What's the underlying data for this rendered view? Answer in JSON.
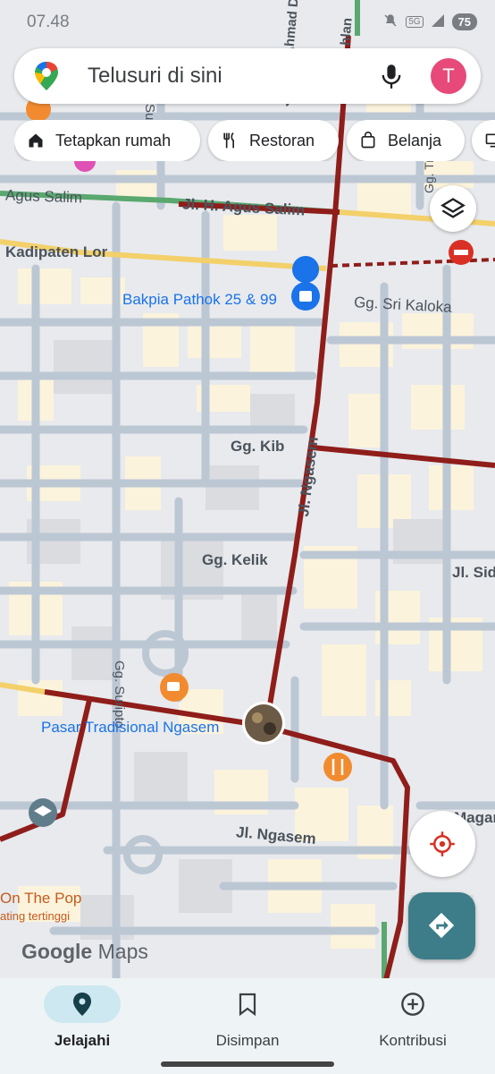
{
  "status_bar": {
    "time": "07.48",
    "network": "5G",
    "battery": "75"
  },
  "search": {
    "placeholder": "Telusuri di sini",
    "avatar_letter": "T"
  },
  "chips": [
    {
      "label": "Tetapkan rumah",
      "icon": "home-icon"
    },
    {
      "label": "Restoran",
      "icon": "restaurant-icon"
    },
    {
      "label": "Belanja",
      "icon": "shopping-bag-icon"
    }
  ],
  "map_labels": {
    "agus_salim_left": "Agus Salim",
    "agus_salim_main": "Jl. H. Agus Salim",
    "kadipaten": "Kadipaten Lor",
    "nyai_ahmad": "Jl. Nyai Ahmad Dahlan",
    "bakpia": "Bakpia Pathok 25 & 99",
    "sri_kaloka": "Gg. Sri Kaloka",
    "kib": "Gg. Kib",
    "ngasem_vertical": "Jl. Ngasem",
    "kelik": "Gg. Kelik",
    "jl_sid": "Jl. Sid",
    "suripto": "Gg. Suripto",
    "pasar": "Pasar Tradisional Ngasem",
    "ngasem_lower": "Jl. Ngasem",
    "magan": "Magan",
    "on_the_pop": "On The Pop",
    "rating": "ating tertinggi",
    "salim_top": "Su",
    "dahlan_top": "hlan",
    "gg_vertical_top": "Gg. Tr"
  },
  "branding": {
    "google": "Google",
    "maps": "Maps"
  },
  "bottom_nav": [
    {
      "label": "Jelajahi",
      "icon": "explore-pin-icon",
      "active": true
    },
    {
      "label": "Disimpan",
      "icon": "bookmark-icon",
      "active": false
    },
    {
      "label": "Kontribusi",
      "icon": "add-circle-icon",
      "active": false
    }
  ],
  "colors": {
    "traffic_red": "#8f1d1a",
    "road_yellow": "#f3d06a",
    "block_cream": "#fbf3dc",
    "accent_teal": "#3d7d89",
    "avatar_pink": "#e6497a"
  }
}
